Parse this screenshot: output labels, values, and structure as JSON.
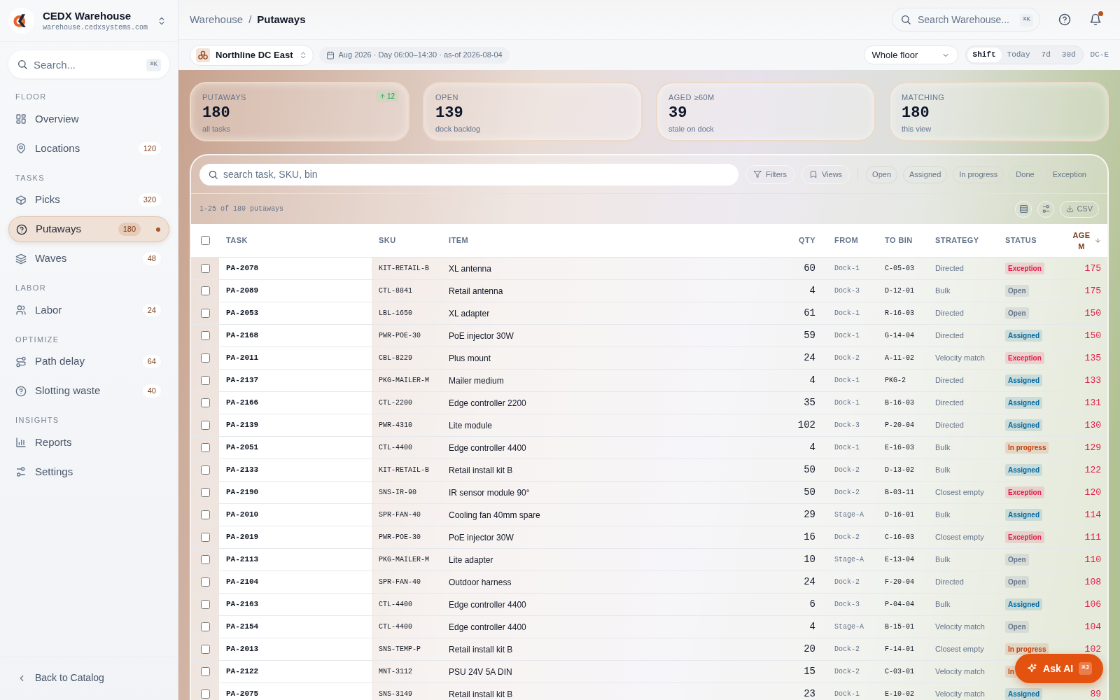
{
  "app": {
    "name": "CEDX Warehouse",
    "domain": "warehouse.cedxsystems.com"
  },
  "sidebar": {
    "search": {
      "placeholder": "Search...",
      "shortcut": "⌘K"
    },
    "groups": [
      {
        "title": "FLOOR",
        "items": [
          {
            "label": "Overview",
            "selected": false
          },
          {
            "label": "Locations",
            "count": "120",
            "selected": false
          }
        ]
      },
      {
        "title": "TASKS",
        "items": [
          {
            "label": "Picks",
            "count": "320",
            "selected": false
          },
          {
            "label": "Putaways",
            "count": "180",
            "selected": true
          },
          {
            "label": "Waves",
            "count": "48",
            "selected": false
          }
        ]
      },
      {
        "title": "LABOR",
        "items": [
          {
            "label": "Labor",
            "count": "24",
            "selected": false
          }
        ]
      },
      {
        "title": "OPTIMIZE",
        "items": [
          {
            "label": "Path delay",
            "count": "64",
            "selected": false
          },
          {
            "label": "Slotting waste",
            "count": "40",
            "selected": false
          }
        ]
      },
      {
        "title": "INSIGHTS",
        "items": [
          {
            "label": "Reports",
            "selected": false
          },
          {
            "label": "Settings",
            "selected": false
          }
        ]
      }
    ],
    "footer": "Back to Catalog"
  },
  "header": {
    "breadcrumb": [
      "Warehouse",
      "Putaways"
    ],
    "separator": "/",
    "search": {
      "placeholder": "Search Warehouse...",
      "shortcut": "⌘K"
    },
    "notifications_unread": true
  },
  "filter_bar": {
    "site": "Northline DC East",
    "period": "Aug 2026 · Day 06:00–14:30 · as-of 2026-08-04",
    "zone": "Whole floor",
    "ranges": [
      {
        "label": "Shift",
        "selected": true
      },
      {
        "label": "Today",
        "selected": false
      },
      {
        "label": "7d",
        "selected": false
      },
      {
        "label": "30d",
        "selected": false
      }
    ],
    "site_code": "DC-E"
  },
  "kpis": [
    {
      "label": "PUTAWAYS",
      "value": "180",
      "sub": "all tasks",
      "delta": "12"
    },
    {
      "label": "OPEN",
      "value": "139",
      "sub": "dock backlog"
    },
    {
      "label": "AGED ≥60M",
      "value": "39",
      "sub": "stale on dock"
    },
    {
      "label": "MATCHING",
      "value": "180",
      "sub": "this view"
    }
  ],
  "table": {
    "search": {
      "placeholder": "search task, SKU, bin"
    },
    "tools": [
      "Filters",
      "Views"
    ],
    "status_filters": [
      {
        "label": "Open",
        "selected": false
      },
      {
        "label": "Assigned",
        "selected": false
      },
      {
        "label": "In progress",
        "selected": false
      },
      {
        "label": "Done",
        "selected": false
      },
      {
        "label": "Exception",
        "selected": false
      }
    ],
    "count": "1-25 of 180 putaways",
    "export": "CSV",
    "all_checked": false,
    "columns": [
      {
        "label": "TASK",
        "sorted": false
      },
      {
        "label": "SKU",
        "sorted": false
      },
      {
        "label": "ITEM",
        "sorted": false
      },
      {
        "label": "QTY",
        "sorted": false
      },
      {
        "label": "FROM",
        "sorted": false
      },
      {
        "label": "TO BIN",
        "sorted": false
      },
      {
        "label": "STRATEGY",
        "sorted": false
      },
      {
        "label": "STATUS",
        "sorted": false
      },
      {
        "label": "AGE M",
        "sorted": true
      }
    ],
    "rows": [
      {
        "checked": false,
        "cells": [
          "PA-2078",
          "KIT-RETAIL-B",
          "XL antenna",
          "60",
          "Dock-1",
          "C-05-03",
          "Directed",
          "Exception",
          "175"
        ],
        "color": "#e11d48"
      },
      {
        "checked": false,
        "cells": [
          "PA-2089",
          "CTL-8841",
          "Retail antenna",
          "4",
          "Dock-3",
          "D-12-01",
          "Bulk",
          "Open",
          "175"
        ],
        "color": "#64748b"
      },
      {
        "checked": false,
        "cells": [
          "PA-2053",
          "LBL-1650",
          "XL adapter",
          "61",
          "Dock-1",
          "R-16-03",
          "Directed",
          "Open",
          "150"
        ],
        "color": "#64748b"
      },
      {
        "checked": false,
        "cells": [
          "PA-2168",
          "PWR-POE-30",
          "PoE injector 30W",
          "59",
          "Dock-1",
          "G-14-04",
          "Directed",
          "Assigned",
          "150"
        ],
        "color": "#0369a1"
      },
      {
        "checked": false,
        "cells": [
          "PA-2011",
          "CBL-8229",
          "Plus mount",
          "24",
          "Dock-2",
          "A-11-02",
          "Velocity match",
          "Exception",
          "135"
        ],
        "color": "#e11d48"
      },
      {
        "checked": false,
        "cells": [
          "PA-2137",
          "PKG-MAILER-M",
          "Mailer medium",
          "4",
          "Dock-1",
          "PKG-2",
          "Directed",
          "Assigned",
          "133"
        ],
        "color": "#0369a1"
      },
      {
        "checked": false,
        "cells": [
          "PA-2166",
          "CTL-2200",
          "Edge controller 2200",
          "35",
          "Dock-1",
          "B-16-03",
          "Directed",
          "Assigned",
          "131"
        ],
        "color": "#0369a1"
      },
      {
        "checked": false,
        "cells": [
          "PA-2139",
          "PWR-4310",
          "Lite module",
          "102",
          "Dock-3",
          "P-20-04",
          "Directed",
          "Assigned",
          "130"
        ],
        "color": "#0369a1"
      },
      {
        "checked": false,
        "cells": [
          "PA-2051",
          "CTL-4400",
          "Edge controller 4400",
          "4",
          "Dock-1",
          "E-16-03",
          "Bulk",
          "In progress",
          "129"
        ],
        "color": "#c2410c"
      },
      {
        "checked": false,
        "cells": [
          "PA-2133",
          "KIT-RETAIL-B",
          "Retail install kit B",
          "50",
          "Dock-2",
          "D-13-02",
          "Bulk",
          "Assigned",
          "122"
        ],
        "color": "#0369a1"
      },
      {
        "checked": false,
        "cells": [
          "PA-2190",
          "SNS-IR-90",
          "IR sensor module 90°",
          "50",
          "Dock-2",
          "B-03-11",
          "Closest empty",
          "Exception",
          "120"
        ],
        "color": "#e11d48"
      },
      {
        "checked": false,
        "cells": [
          "PA-2010",
          "SPR-FAN-40",
          "Cooling fan 40mm spare",
          "29",
          "Stage-A",
          "D-16-01",
          "Bulk",
          "Assigned",
          "114"
        ],
        "color": "#0369a1"
      },
      {
        "checked": false,
        "cells": [
          "PA-2019",
          "PWR-POE-30",
          "PoE injector 30W",
          "16",
          "Dock-2",
          "C-16-03",
          "Closest empty",
          "Exception",
          "111"
        ],
        "color": "#e11d48"
      },
      {
        "checked": false,
        "cells": [
          "PA-2113",
          "PKG-MAILER-M",
          "Lite adapter",
          "10",
          "Stage-A",
          "E-13-04",
          "Bulk",
          "Open",
          "110"
        ],
        "color": "#64748b"
      },
      {
        "checked": false,
        "cells": [
          "PA-2104",
          "SPR-FAN-40",
          "Outdoor harness",
          "24",
          "Dock-2",
          "F-20-04",
          "Directed",
          "Open",
          "108"
        ],
        "color": "#64748b"
      },
      {
        "checked": false,
        "cells": [
          "PA-2163",
          "CTL-4400",
          "Edge controller 4400",
          "6",
          "Dock-3",
          "P-04-04",
          "Bulk",
          "Assigned",
          "106"
        ],
        "color": "#0369a1"
      },
      {
        "checked": false,
        "cells": [
          "PA-2154",
          "CTL-4400",
          "Edge controller 4400",
          "4",
          "Stage-A",
          "B-15-01",
          "Velocity match",
          "Open",
          "104"
        ],
        "color": "#64748b"
      },
      {
        "checked": false,
        "cells": [
          "PA-2013",
          "SNS-TEMP-P",
          "Retail install kit B",
          "20",
          "Dock-2",
          "F-14-01",
          "Closest empty",
          "In progress",
          "102"
        ],
        "color": "#c2410c"
      },
      {
        "checked": false,
        "cells": [
          "PA-2122",
          "MNT-3112",
          "PSU 24V 5A DIN",
          "15",
          "Dock-2",
          "C-03-01",
          "Velocity match",
          "In"
        ],
        "color": "#c2410c"
      },
      {
        "checked": false,
        "cells": [
          "PA-2075",
          "SNS-3149",
          "Retail install kit B",
          "23",
          "Dock-1",
          "E-10-02",
          "Velocity match",
          "Assigned",
          "89"
        ],
        "color": "#0369a1"
      }
    ]
  },
  "assistant_button": {
    "label": "Ask AI",
    "shortcut": "⌘J"
  }
}
